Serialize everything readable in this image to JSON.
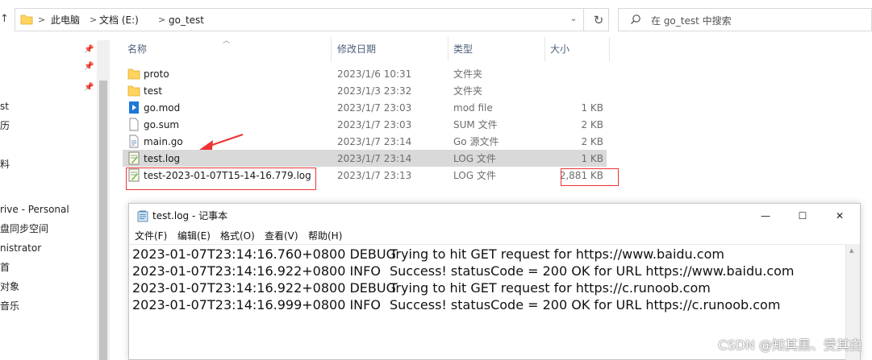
{
  "address_bar": {
    "breadcrumbs": [
      "此电脑",
      "文档 (E:)",
      "go_test"
    ],
    "separator": ">",
    "dropdown_glyph": "⌄",
    "refresh_glyph": "↻"
  },
  "search": {
    "placeholder": "在 go_test 中搜索"
  },
  "nav_pane": {
    "items": [
      "st",
      "历",
      "料",
      "rive - Personal",
      "盘同步空间",
      "nistrator",
      "首",
      "对象",
      "音乐"
    ],
    "pin_glyph": "📌"
  },
  "columns": {
    "name": "名称",
    "date": "修改日期",
    "type": "类型",
    "size": "大小"
  },
  "files": [
    {
      "name": "proto",
      "date": "2023/1/6 10:31",
      "type": "文件夹",
      "size": "",
      "icon": "folder-icon"
    },
    {
      "name": "test",
      "date": "2023/1/3 23:32",
      "type": "文件夹",
      "size": "",
      "icon": "folder-icon"
    },
    {
      "name": "go.mod",
      "date": "2023/1/7 23:03",
      "type": "mod file",
      "size": "1 KB",
      "icon": "media-file-icon"
    },
    {
      "name": "go.sum",
      "date": "2023/1/7 23:03",
      "type": "SUM 文件",
      "size": "2 KB",
      "icon": "blank-file-icon"
    },
    {
      "name": "main.go",
      "date": "2023/1/7 23:14",
      "type": "Go 源文件",
      "size": "2 KB",
      "icon": "source-file-icon"
    },
    {
      "name": "test.log",
      "date": "2023/1/7 23:14",
      "type": "LOG 文件",
      "size": "1 KB",
      "icon": "log-file-icon",
      "selected": true
    },
    {
      "name": "test-2023-01-07T15-14-16.779.log",
      "date": "2023/1/7 23:13",
      "type": "LOG 文件",
      "size": "2,881 KB",
      "icon": "log-file-icon"
    }
  ],
  "notepad": {
    "title": "test.log - 记事本",
    "menu": [
      "文件(F)",
      "编辑(E)",
      "格式(O)",
      "查看(V)",
      "帮助(H)"
    ],
    "lines": [
      {
        "ts": "2023-01-07T23:14:16.760+0800 DEBUG",
        "msg": "Trying to hit GET request for https://www.baidu.com"
      },
      {
        "ts": "2023-01-07T23:14:16.922+0800 INFO",
        "msg": "Success! statusCode = 200 OK for URL https://www.baidu.com"
      },
      {
        "ts": "2023-01-07T23:14:16.922+0800 DEBUG",
        "msg": "Trying to hit GET request for https://c.runoob.com"
      },
      {
        "ts": "2023-01-07T23:14:16.999+0800 INFO",
        "msg": "Success! statusCode = 200 OK for URL https://c.runoob.com"
      }
    ],
    "minimize_glyph": "—",
    "maximize_glyph": "☐",
    "close_glyph": "✕"
  },
  "watermark": "CSDN @知其黑、受其白",
  "colors": {
    "annotation": "#e33333",
    "selection": "#d9d9d9",
    "folder": "#ffd45e"
  }
}
